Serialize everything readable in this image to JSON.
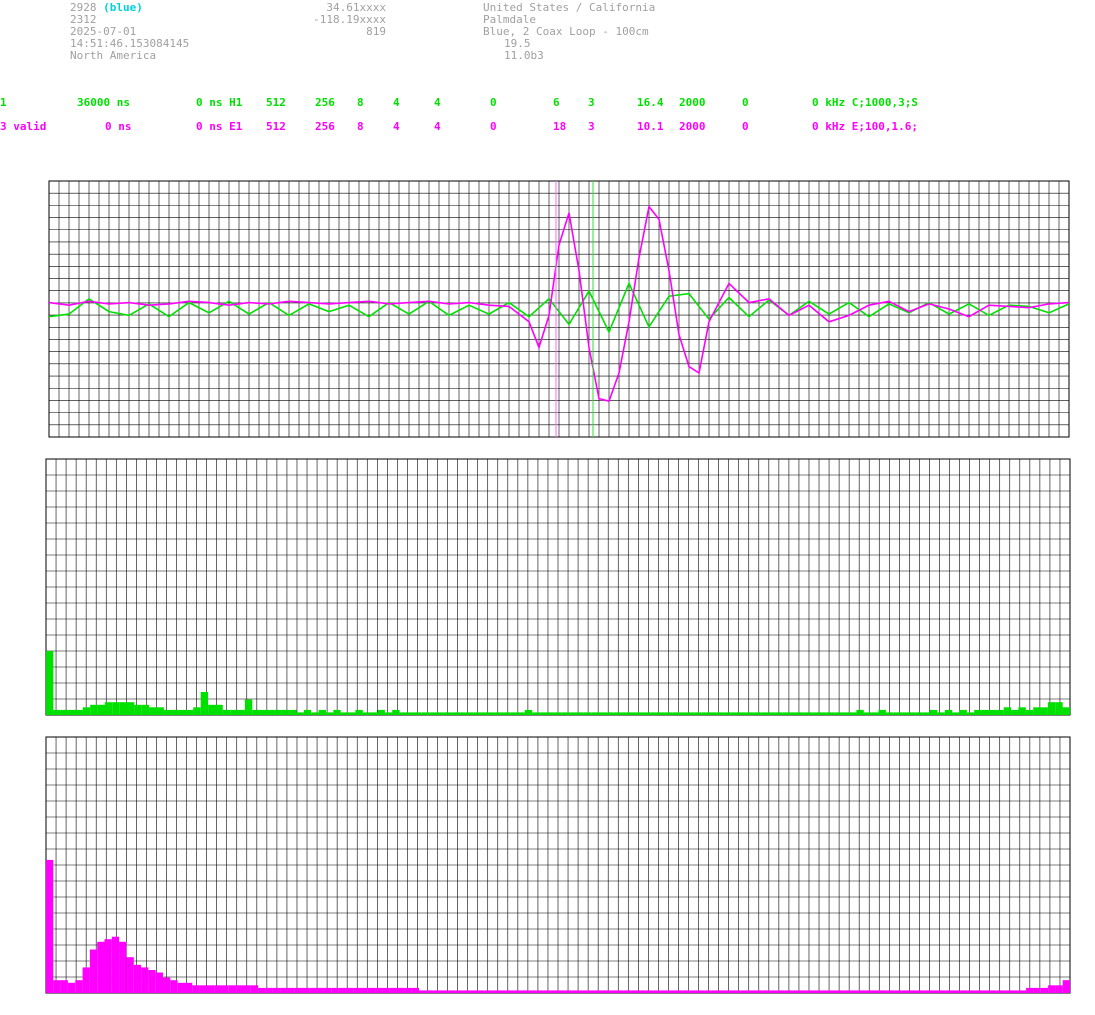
{
  "header": {
    "station_id": "2928",
    "station_color": "(blue)",
    "line2": "2312",
    "date": "2025-07-01",
    "time": "14:51:46.153084145",
    "region": "North America",
    "lat": "34.61xxxx",
    "lon": "-118.19xxxx",
    "alt": "819",
    "country": "United States / California",
    "city": "Palmdale",
    "antenna": "Blue, 2 Coax Loop - 100cm",
    "val1": "19.5",
    "version": "11.0b3"
  },
  "status_rows": [
    {
      "cells": [
        "1",
        "36000 ns",
        "0 ns H1",
        "512",
        "256",
        "8",
        "4",
        "4",
        "0",
        "6",
        "3",
        "16.4",
        "2000",
        "0",
        "0 kHz C;1000,3;S"
      ]
    },
    {
      "cells": [
        "3 valid",
        "0 ns",
        "0 ns E1",
        "512",
        "256",
        "8",
        "4",
        "4",
        "0",
        "18",
        "3",
        "10.1",
        "2000",
        "0",
        "0 kHz E;100,1.6;"
      ]
    }
  ],
  "colors": {
    "green": "#00e000",
    "magenta": "#ff00ff",
    "grid": "#000000",
    "header_gray": "#a0a0a0",
    "cyan": "#00d0e0"
  },
  "chart_data": [
    {
      "type": "line",
      "grid": true,
      "ylim": [
        -1,
        1
      ],
      "series": [
        {
          "color": "#00e000",
          "x": [
            0,
            20,
            40,
            60,
            80,
            100,
            120,
            140,
            160,
            180,
            200,
            220,
            240,
            260,
            280,
            300,
            320,
            340,
            360,
            380,
            400,
            420,
            440,
            460,
            480,
            500,
            520,
            540,
            560,
            580,
            600,
            620,
            640,
            660,
            680,
            700,
            720,
            740,
            760,
            780,
            800,
            820,
            840,
            860,
            880,
            900,
            920,
            940,
            960,
            980,
            1000,
            1020
          ],
          "y": [
            -0.06,
            -0.04,
            0.08,
            -0.02,
            -0.05,
            0.04,
            -0.06,
            0.05,
            -0.03,
            0.06,
            -0.04,
            0.05,
            -0.05,
            0.04,
            -0.02,
            0.03,
            -0.06,
            0.05,
            -0.04,
            0.06,
            -0.05,
            0.03,
            -0.04,
            0.05,
            -0.06,
            0.08,
            -0.12,
            0.14,
            -0.18,
            0.2,
            -0.14,
            0.1,
            0.12,
            -0.08,
            0.09,
            -0.06,
            0.07,
            -0.05,
            0.06,
            -0.04,
            0.05,
            -0.06,
            0.04,
            -0.03,
            0.05,
            -0.04,
            0.04,
            -0.05,
            0.03,
            0.02,
            -0.03,
            0.04
          ]
        },
        {
          "color": "#ff00ff",
          "x": [
            0,
            20,
            40,
            60,
            80,
            100,
            120,
            140,
            160,
            180,
            200,
            220,
            240,
            260,
            280,
            300,
            320,
            340,
            360,
            380,
            400,
            420,
            440,
            460,
            480,
            490,
            500,
            510,
            520,
            530,
            540,
            550,
            560,
            570,
            580,
            590,
            600,
            610,
            620,
            630,
            640,
            650,
            660,
            680,
            700,
            720,
            740,
            760,
            780,
            800,
            820,
            840,
            860,
            880,
            900,
            920,
            940,
            960,
            980,
            1000,
            1020
          ],
          "y": [
            0.05,
            0.03,
            0.06,
            0.04,
            0.05,
            0.03,
            0.04,
            0.06,
            0.05,
            0.03,
            0.05,
            0.04,
            0.06,
            0.05,
            0.04,
            0.05,
            0.06,
            0.04,
            0.05,
            0.06,
            0.04,
            0.05,
            0.03,
            0.02,
            -0.1,
            -0.3,
            -0.05,
            0.5,
            0.75,
            0.3,
            -0.3,
            -0.7,
            -0.72,
            -0.5,
            -0.1,
            0.4,
            0.8,
            0.7,
            0.3,
            -0.2,
            -0.45,
            -0.5,
            -0.1,
            0.2,
            0.05,
            0.08,
            -0.05,
            0.03,
            -0.1,
            -0.05,
            0.03,
            0.06,
            -0.02,
            0.04,
            0.0,
            -0.06,
            0.03,
            0.02,
            0.01,
            0.04,
            0.05
          ]
        }
      ]
    },
    {
      "type": "bar",
      "grid": true,
      "ylim": [
        0,
        1
      ],
      "series": [
        {
          "color": "#00e000",
          "values": [
            0.25,
            0.02,
            0.02,
            0.02,
            0.02,
            0.03,
            0.04,
            0.04,
            0.05,
            0.05,
            0.05,
            0.05,
            0.04,
            0.04,
            0.03,
            0.03,
            0.02,
            0.02,
            0.02,
            0.02,
            0.03,
            0.09,
            0.04,
            0.04,
            0.02,
            0.02,
            0.02,
            0.06,
            0.02,
            0.02,
            0.02,
            0.02,
            0.02,
            0.02,
            0.01,
            0.02,
            0.01,
            0.02,
            0.01,
            0.02,
            0.01,
            0.01,
            0.02,
            0.01,
            0.01,
            0.02,
            0.01,
            0.02,
            0.01,
            0.01,
            0.01,
            0.01,
            0.01,
            0.01,
            0.01,
            0.01,
            0.01,
            0.01,
            0.01,
            0.01,
            0.01,
            0.01,
            0.01,
            0.01,
            0.01,
            0.02,
            0.01,
            0.01,
            0.01,
            0.01,
            0.01,
            0.01,
            0.01,
            0.01,
            0.01,
            0.01,
            0.01,
            0.01,
            0.01,
            0.01,
            0.01,
            0.01,
            0.01,
            0.01,
            0.01,
            0.01,
            0.01,
            0.01,
            0.01,
            0.01,
            0.01,
            0.01,
            0.01,
            0.01,
            0.01,
            0.01,
            0.01,
            0.01,
            0.01,
            0.01,
            0.01,
            0.01,
            0.01,
            0.01,
            0.01,
            0.01,
            0.01,
            0.01,
            0.01,
            0.01,
            0.02,
            0.01,
            0.01,
            0.02,
            0.01,
            0.01,
            0.01,
            0.01,
            0.01,
            0.01,
            0.02,
            0.01,
            0.02,
            0.01,
            0.02,
            0.01,
            0.02,
            0.02,
            0.02,
            0.02,
            0.03,
            0.02,
            0.03,
            0.02,
            0.03,
            0.03,
            0.05,
            0.05,
            0.03
          ]
        }
      ]
    },
    {
      "type": "bar",
      "grid": true,
      "ylim": [
        0,
        1
      ],
      "series": [
        {
          "color": "#ff00ff",
          "values": [
            0.52,
            0.05,
            0.05,
            0.04,
            0.05,
            0.1,
            0.17,
            0.2,
            0.21,
            0.22,
            0.2,
            0.14,
            0.11,
            0.1,
            0.09,
            0.08,
            0.06,
            0.05,
            0.04,
            0.04,
            0.03,
            0.03,
            0.03,
            0.03,
            0.03,
            0.03,
            0.03,
            0.03,
            0.03,
            0.02,
            0.02,
            0.02,
            0.02,
            0.02,
            0.02,
            0.02,
            0.02,
            0.02,
            0.02,
            0.02,
            0.02,
            0.02,
            0.02,
            0.02,
            0.02,
            0.02,
            0.02,
            0.02,
            0.02,
            0.02,
            0.02,
            0.01,
            0.01,
            0.01,
            0.01,
            0.01,
            0.01,
            0.01,
            0.01,
            0.01,
            0.01,
            0.01,
            0.01,
            0.01,
            0.01,
            0.01,
            0.01,
            0.01,
            0.01,
            0.01,
            0.01,
            0.01,
            0.01,
            0.01,
            0.01,
            0.01,
            0.01,
            0.01,
            0.01,
            0.01,
            0.01,
            0.01,
            0.01,
            0.01,
            0.01,
            0.01,
            0.01,
            0.01,
            0.01,
            0.01,
            0.01,
            0.01,
            0.01,
            0.01,
            0.01,
            0.01,
            0.01,
            0.01,
            0.01,
            0.01,
            0.01,
            0.01,
            0.01,
            0.01,
            0.01,
            0.01,
            0.01,
            0.01,
            0.01,
            0.01,
            0.01,
            0.01,
            0.01,
            0.01,
            0.01,
            0.01,
            0.01,
            0.01,
            0.01,
            0.01,
            0.01,
            0.01,
            0.01,
            0.01,
            0.01,
            0.01,
            0.01,
            0.01,
            0.01,
            0.01,
            0.01,
            0.01,
            0.01,
            0.01,
            0.02,
            0.02,
            0.02,
            0.03,
            0.03,
            0.05
          ]
        }
      ]
    }
  ]
}
